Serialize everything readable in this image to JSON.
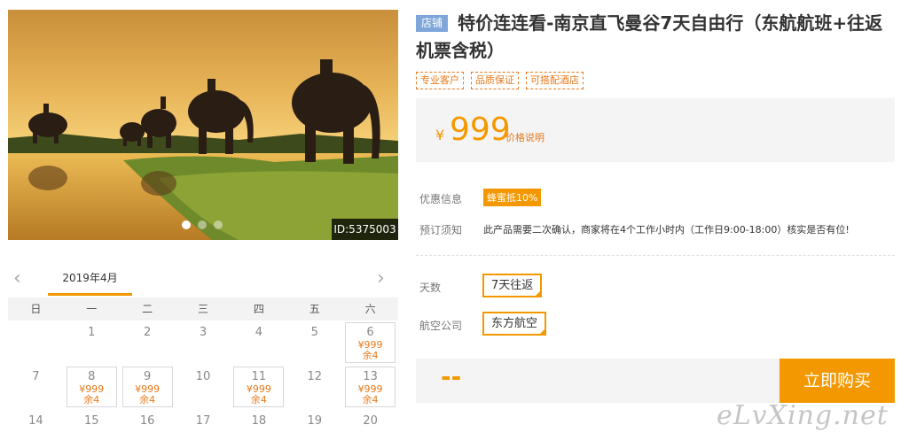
{
  "gallery": {
    "image_alt": "Elephants with riders walking by a lake at sunset",
    "image_id": "ID:5375003",
    "slide_count": 3,
    "active_slide": 1
  },
  "calendar": {
    "month_label": "2019年4月",
    "prev_icon": "chevron-left-icon",
    "next_icon": "chevron-right-icon",
    "weekdays": [
      "日",
      "一",
      "二",
      "三",
      "四",
      "五",
      "六"
    ],
    "days": [
      {
        "day": "",
        "avail": false
      },
      {
        "day": "1",
        "avail": false
      },
      {
        "day": "2",
        "avail": false
      },
      {
        "day": "3",
        "avail": false
      },
      {
        "day": "4",
        "avail": false
      },
      {
        "day": "5",
        "avail": false
      },
      {
        "day": "6",
        "avail": true,
        "price": "¥999",
        "stock": "余4"
      },
      {
        "day": "7",
        "avail": false
      },
      {
        "day": "8",
        "avail": true,
        "price": "¥999",
        "stock": "余4"
      },
      {
        "day": "9",
        "avail": true,
        "price": "¥999",
        "stock": "余4"
      },
      {
        "day": "10",
        "avail": false
      },
      {
        "day": "11",
        "avail": true,
        "price": "¥999",
        "stock": "余4"
      },
      {
        "day": "12",
        "avail": false
      },
      {
        "day": "13",
        "avail": true,
        "price": "¥999",
        "stock": "余4"
      },
      {
        "day": "14",
        "avail": false
      },
      {
        "day": "15",
        "avail": false
      },
      {
        "day": "16",
        "avail": false
      },
      {
        "day": "17",
        "avail": false
      },
      {
        "day": "18",
        "avail": false
      },
      {
        "day": "19",
        "avail": false
      },
      {
        "day": "20",
        "avail": false
      }
    ]
  },
  "product": {
    "shop_tag": "店铺",
    "title": "特价连连看-南京直飞曼谷7天自由行（东航航班+往返机票含税）",
    "badges": [
      "专业客户",
      "品质保证",
      "可搭配酒店"
    ],
    "currency": "¥",
    "price": "999",
    "price_note": "价格说明",
    "promo_label": "优惠信息",
    "promo_tag": "蜂蜜抵10%",
    "notice_label": "预订须知",
    "notice_text": "此产品需要二次确认，商家将在4个工作小时内（工作日9:00-18:00）核实是否有位!",
    "days_label": "天数",
    "days_option": "7天往返",
    "airline_label": "航空公司",
    "airline_option": "东方航空",
    "quantity_placeholder": "--",
    "buy_label": "立即购买"
  },
  "watermark": "eLvXing.net",
  "colors": {
    "accent": "#f39800",
    "accent_text": "#e8791a",
    "shop_tag_bg": "#7fa6d9",
    "panel_bg": "#f4f4f4"
  }
}
